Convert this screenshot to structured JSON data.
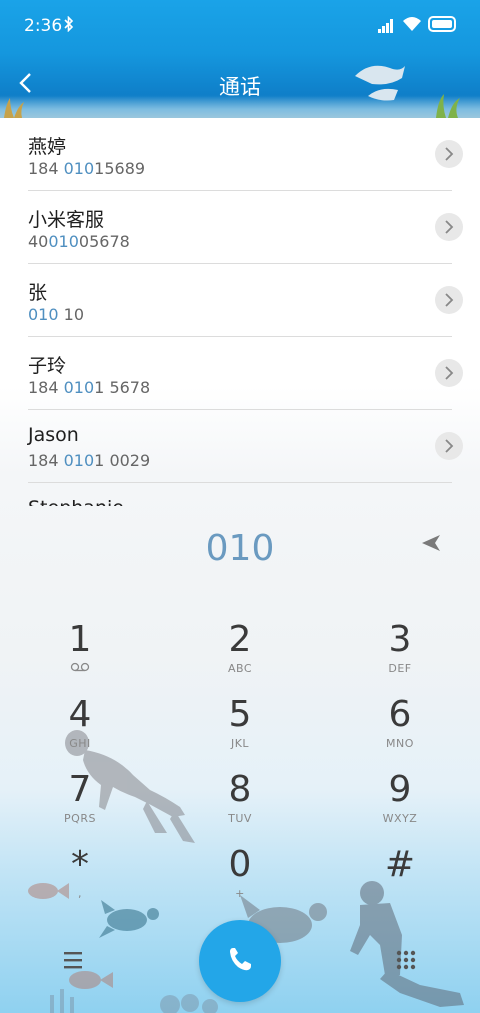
{
  "status": {
    "time": "2:36"
  },
  "header": {
    "title": "通话"
  },
  "contacts": [
    {
      "name": "燕婷",
      "num_pre": "184 ",
      "num_hl": "010",
      "num_post": "15689"
    },
    {
      "name": "小米客服",
      "num_pre": "40",
      "num_hl": "010",
      "num_post": "05678"
    },
    {
      "name": "张",
      "num_pre": "",
      "num_hl": "010",
      "num_post": " 10"
    },
    {
      "name": "子玲",
      "num_pre": "184 ",
      "num_hl": "010",
      "num_post": "1 5678"
    },
    {
      "name": "Jason",
      "num_pre": "184 ",
      "num_hl": "010",
      "num_post": "1 0029"
    },
    {
      "name": "Stephanie",
      "num_pre": "",
      "num_hl": "",
      "num_post": ""
    }
  ],
  "dialer": {
    "typed": "010"
  },
  "keys": [
    {
      "digit": "1",
      "letters": ""
    },
    {
      "digit": "2",
      "letters": "ABC"
    },
    {
      "digit": "3",
      "letters": "DEF"
    },
    {
      "digit": "4",
      "letters": "GHI"
    },
    {
      "digit": "5",
      "letters": "JKL"
    },
    {
      "digit": "6",
      "letters": "MNO"
    },
    {
      "digit": "7",
      "letters": "PQRS"
    },
    {
      "digit": "8",
      "letters": "TUV"
    },
    {
      "digit": "9",
      "letters": "WXYZ"
    },
    {
      "digit": "*",
      "letters": ","
    },
    {
      "digit": "0",
      "letters": "+"
    },
    {
      "digit": "#",
      "letters": ""
    }
  ],
  "colors": {
    "accent": "#23a6e8",
    "highlight": "#4f8fc0",
    "header": "#1597de"
  },
  "icons": [
    "bluetooth-icon",
    "signal-icon",
    "wifi-icon",
    "battery-icon",
    "back-icon",
    "chevron-right-icon",
    "delete-icon",
    "voicemail-icon",
    "menu-icon",
    "phone-icon",
    "keypad-icon"
  ]
}
